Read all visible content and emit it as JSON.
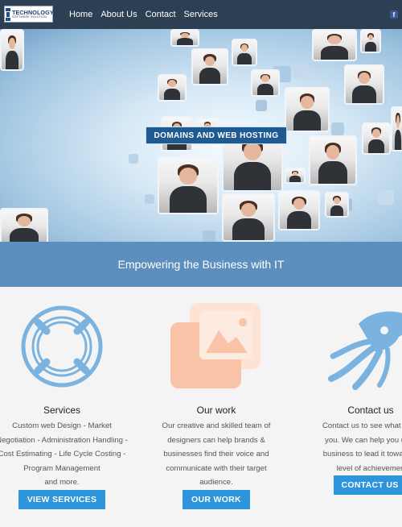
{
  "nav": {
    "logo": {
      "title": "TECHNOLOGY",
      "subtitle": "SOFTWARE SOLUTION"
    },
    "items": [
      "Home",
      "About Us",
      "Contact",
      "Services"
    ],
    "social_icon": "facebook-icon",
    "social_label": "f"
  },
  "hero": {
    "label": "DOMAINS AND WEB HOSTING"
  },
  "band": {
    "text": "Empowering the Business with IT"
  },
  "columns": [
    {
      "icon": "lifebuoy-icon",
      "title": "Services",
      "lines": [
        "Custom web Design - Market",
        "Negotiation - Administration Handling -",
        "Cost Estimating - Life Cycle Costing -",
        "Program Management",
        "and more."
      ],
      "button": "VIEW SERVICES"
    },
    {
      "icon": "image-gallery-icon",
      "title": "Our work",
      "lines": [
        "Our creative and skilled team of",
        "designers can help brands &",
        "businesses find their voice and",
        "communicate with their target",
        "audience."
      ],
      "button": "OUR WORK"
    },
    {
      "icon": "squid-icon",
      "title": "Contact us",
      "lines": [
        "Contact us to see what we c",
        "you. We can help you upgr",
        "business to lead it towards t",
        "level of achievemen"
      ],
      "button": "CONTACT US"
    }
  ],
  "colors": {
    "nav_bg": "#2d3f52",
    "band_bg": "#5c8fbe",
    "button_bg": "#2d95dc",
    "icon_blue": "#7ab3df",
    "icon_peach": "#f9c3a8"
  }
}
